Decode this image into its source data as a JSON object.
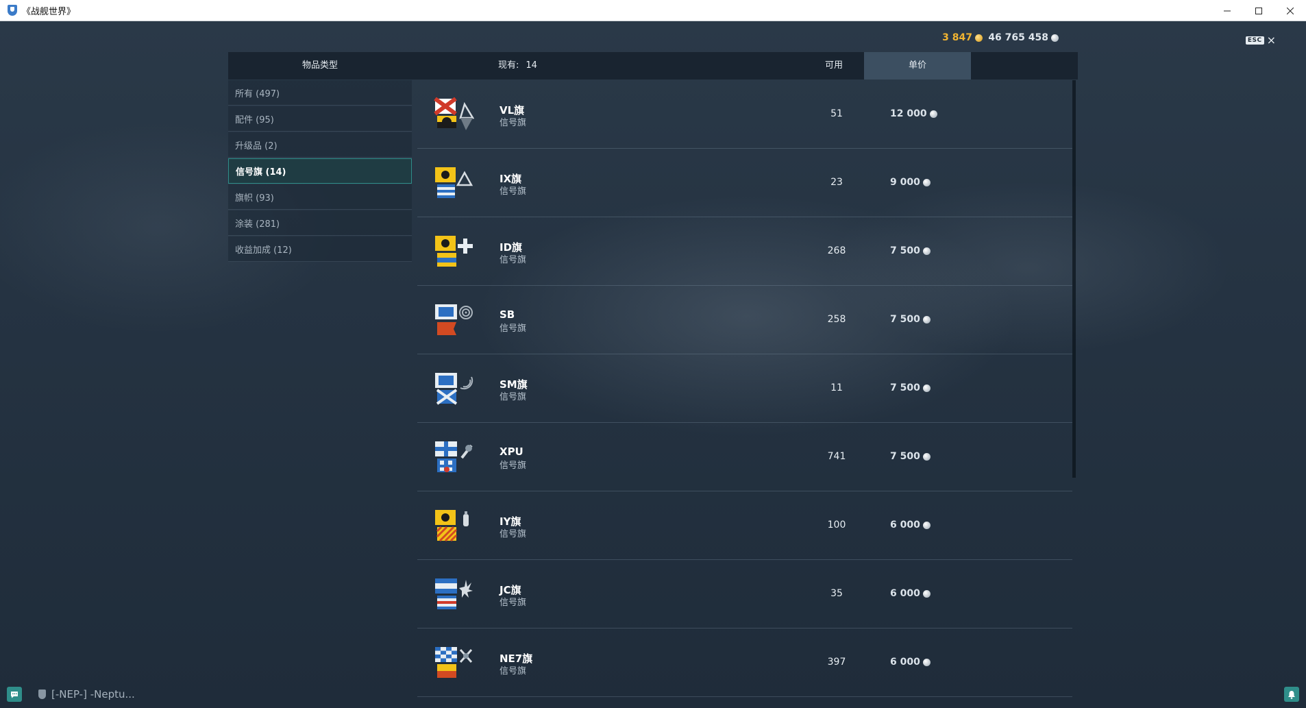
{
  "window": {
    "title": "《战舰世界》",
    "minimize_icon": "minimize-icon",
    "maximize_icon": "maximize-icon",
    "close_icon": "close-icon"
  },
  "currency": {
    "doubloons": "3 847",
    "credits": "46 765 458"
  },
  "esc": {
    "key_label": "ESC",
    "close_glyph": "×"
  },
  "header": {
    "type_label": "物品类型",
    "count_label": "现有:",
    "count_value": "14",
    "available_label": "可用",
    "price_label": "单价"
  },
  "sidebar": {
    "items": [
      {
        "label": "所有 (497)",
        "active": false
      },
      {
        "label": "配件 (95)",
        "active": false
      },
      {
        "label": "升级品 (2)",
        "active": false
      },
      {
        "label": "信号旗 (14)",
        "active": true
      },
      {
        "label": "旗帜 (93)",
        "active": false
      },
      {
        "label": "涂装 (281)",
        "active": false
      },
      {
        "label": "收益加成 (12)",
        "active": false
      }
    ]
  },
  "items": [
    {
      "name": "VL旗",
      "type": "信号旗",
      "available": "51",
      "price": "12 000",
      "icon": "flag-vl-icon"
    },
    {
      "name": "IX旗",
      "type": "信号旗",
      "available": "23",
      "price": "9 000",
      "icon": "flag-ix-icon"
    },
    {
      "name": "ID旗",
      "type": "信号旗",
      "available": "268",
      "price": "7 500",
      "icon": "flag-id-icon"
    },
    {
      "name": "SB",
      "type": "信号旗",
      "available": "258",
      "price": "7 500",
      "icon": "flag-sb-icon"
    },
    {
      "name": "SM旗",
      "type": "信号旗",
      "available": "11",
      "price": "7 500",
      "icon": "flag-sm-icon"
    },
    {
      "name": "XPU",
      "type": "信号旗",
      "available": "741",
      "price": "7 500",
      "icon": "flag-xpu-icon"
    },
    {
      "name": "IY旗",
      "type": "信号旗",
      "available": "100",
      "price": "6 000",
      "icon": "flag-iy-icon"
    },
    {
      "name": "JC旗",
      "type": "信号旗",
      "available": "35",
      "price": "6 000",
      "icon": "flag-jc-icon"
    },
    {
      "name": "NE7旗",
      "type": "信号旗",
      "available": "397",
      "price": "6 000",
      "icon": "flag-ne7-icon"
    }
  ],
  "bottom": {
    "clan_text": "[-NEP-] -Neptu...",
    "chat_icon": "chat-icon",
    "notification_icon": "bell-icon"
  },
  "colors": {
    "accent": "#2f8e8a",
    "doubloon": "#f2b531",
    "background": "#22303f"
  }
}
